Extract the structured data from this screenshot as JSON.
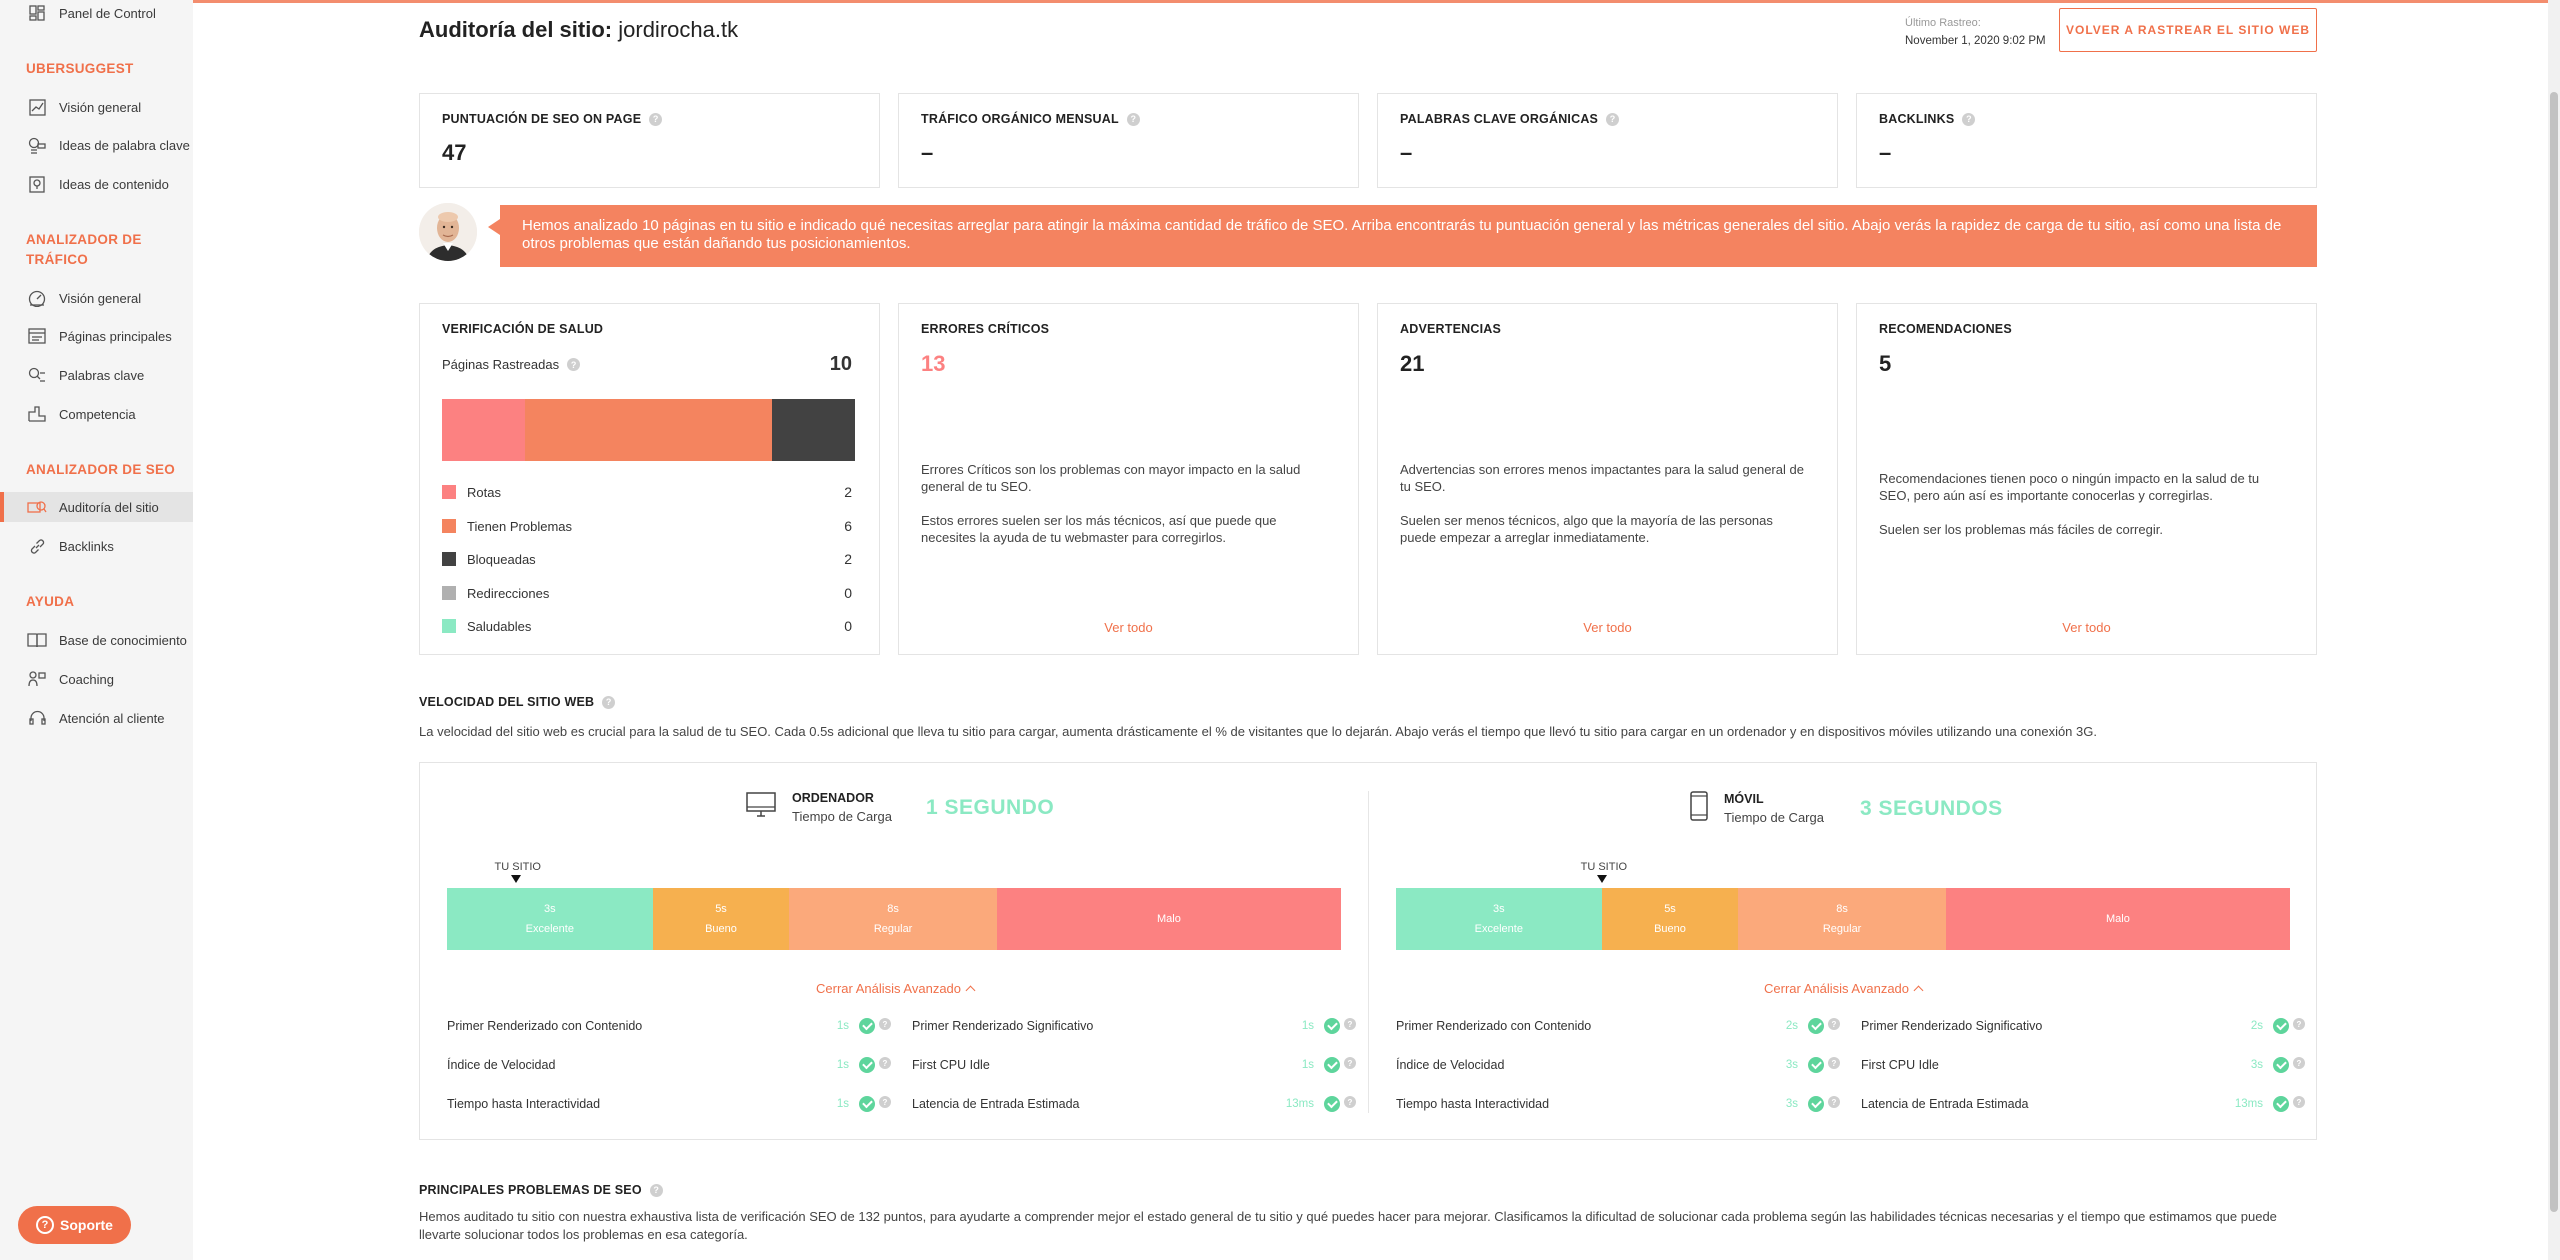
{
  "sidebar": {
    "top_item": "Panel de Control",
    "sections": [
      {
        "title": "UBERSUGGEST",
        "items": [
          "Visión general",
          "Ideas de palabra clave",
          "Ideas de contenido"
        ]
      },
      {
        "title": "ANALIZADOR DE TRÁFICO",
        "items": [
          "Visión general",
          "Páginas principales",
          "Palabras clave",
          "Competencia"
        ]
      },
      {
        "title": "ANALIZADOR DE SEO",
        "items": [
          "Auditoría del sitio",
          "Backlinks"
        ]
      },
      {
        "title": "AYUDA",
        "items": [
          "Base de conocimiento",
          "Coaching",
          "Atención al cliente"
        ]
      }
    ],
    "support_label": "Soporte"
  },
  "header": {
    "title_bold": "Auditoría del sitio:",
    "domain": "jordirocha.tk",
    "last_crawl_label": "Último Rastreo:",
    "last_crawl_value": "November 1, 2020 9:02 PM",
    "recrawl_button": "VOLVER A RASTREAR EL SITIO WEB"
  },
  "metrics": [
    {
      "title": "PUNTUACIÓN DE SEO ON PAGE",
      "value": "47"
    },
    {
      "title": "TRÁFICO ORGÁNICO MENSUAL",
      "value": "–"
    },
    {
      "title": "PALABRAS CLAVE ORGÁNICAS",
      "value": "–"
    },
    {
      "title": "BACKLINKS",
      "value": "–"
    }
  ],
  "banner": "Hemos analizado 10 páginas en tu sitio e indicado qué necesitas arreglar para atingir la máxima cantidad de tráfico de SEO. Arriba encontrarás tu puntuación general y las métricas generales del sitio. Abajo verás la rapidez de carga de tu sitio, así como una lista de otros problemas que están dañando tus posicionamientos.",
  "health": {
    "title": "VERIFICACIÓN DE SALUD",
    "crawled_label": "Páginas Rastreadas",
    "crawled_value": "10",
    "legend": [
      {
        "label": "Rotas",
        "count": "2",
        "color": "#fc8181"
      },
      {
        "label": "Tienen Problemas",
        "count": "6",
        "color": "#f4845f"
      },
      {
        "label": "Bloqueadas",
        "count": "2",
        "color": "#424242"
      },
      {
        "label": "Redirecciones",
        "count": "0",
        "color": "#b0b0b0"
      },
      {
        "label": "Saludables",
        "count": "0",
        "color": "#8be9c3"
      }
    ]
  },
  "issues": [
    {
      "title": "ERRORES CRÍTICOS",
      "value": "13",
      "color": "#fc8181",
      "text1": "Errores Críticos son los problemas con mayor impacto en la salud general de tu SEO.",
      "text2": "Estos errores suelen ser los más técnicos, así que puede que necesites la ayuda de tu webmaster para corregirlos.",
      "link": "Ver todo"
    },
    {
      "title": "ADVERTENCIAS",
      "value": "21",
      "color": "#222222",
      "text1": "Advertencias son errores menos impactantes para la salud general de tu SEO.",
      "text2": "Suelen ser menos técnicos, algo que la mayoría de las personas puede empezar a arreglar inmediatamente.",
      "link": "Ver todo"
    },
    {
      "title": "RECOMENDACIONES",
      "value": "5",
      "color": "#222222",
      "text1": "Recomendaciones tienen poco o ningún impacto en la salud de tu SEO, pero aún así es importante conocerlas y corregirlas.",
      "text2": "Suelen ser los problemas más fáciles de corregir.",
      "link": "Ver todo"
    }
  ],
  "speed": {
    "title": "VELOCIDAD DEL SITIO WEB",
    "desc": "La velocidad del sitio web es crucial para la salud de tu SEO. Cada 0.5s adicional que lleva tu sitio para cargar, aumenta drásticamente el % de visitantes que lo dejarán. Abajo verás el tiempo que llevó tu sitio para cargar en un ordenador y en dispositivos móviles utilizando una conexión 3G.",
    "your_site": "TU SITIO",
    "collapse_label": "Cerrar Análisis Avanzado",
    "segments": [
      {
        "time": "3s",
        "label": "Excelente",
        "color": "#8be9c3"
      },
      {
        "time": "5s",
        "label": "Bueno",
        "color": "#f6b04f"
      },
      {
        "time": "8s",
        "label": "Regular",
        "color": "#fba97b"
      },
      {
        "time": "",
        "label": "Malo",
        "color": "#fc8181"
      }
    ],
    "devices": [
      {
        "name": "ORDENADOR",
        "sub": "Tiempo de Carga",
        "time": "1 SEGUNDO",
        "load_seconds": 1,
        "metrics": [
          {
            "label": "Primer Renderizado con Contenido",
            "value": "1s"
          },
          {
            "label": "Primer Renderizado Significativo",
            "value": "1s"
          },
          {
            "label": "Índice de Velocidad",
            "value": "1s"
          },
          {
            "label": "First CPU Idle",
            "value": "1s"
          },
          {
            "label": "Tiempo hasta Interactividad",
            "value": "1s"
          },
          {
            "label": "Latencia de Entrada Estimada",
            "value": "13ms"
          }
        ]
      },
      {
        "name": "MÓVIL",
        "sub": "Tiempo de Carga",
        "time": "3 SEGUNDOS",
        "load_seconds": 3,
        "metrics": [
          {
            "label": "Primer Renderizado con Contenido",
            "value": "2s"
          },
          {
            "label": "Primer Renderizado Significativo",
            "value": "2s"
          },
          {
            "label": "Índice de Velocidad",
            "value": "3s"
          },
          {
            "label": "First CPU Idle",
            "value": "3s"
          },
          {
            "label": "Tiempo hasta Interactividad",
            "value": "3s"
          },
          {
            "label": "Latencia de Entrada Estimada",
            "value": "13ms"
          }
        ]
      }
    ]
  },
  "seo_issues": {
    "title": "PRINCIPALES PROBLEMAS DE SEO",
    "desc": "Hemos auditado tu sitio con nuestra exhaustiva lista de verificación SEO de 132 puntos, para ayudarte a comprender mejor el estado general de tu sitio y qué puedes hacer para mejorar. Clasificamos la dificultad de solucionar cada problema según las habilidades técnicas necesarias y el tiempo que estimamos que puede llevarte solucionar todos los problemas en esa categoría."
  }
}
